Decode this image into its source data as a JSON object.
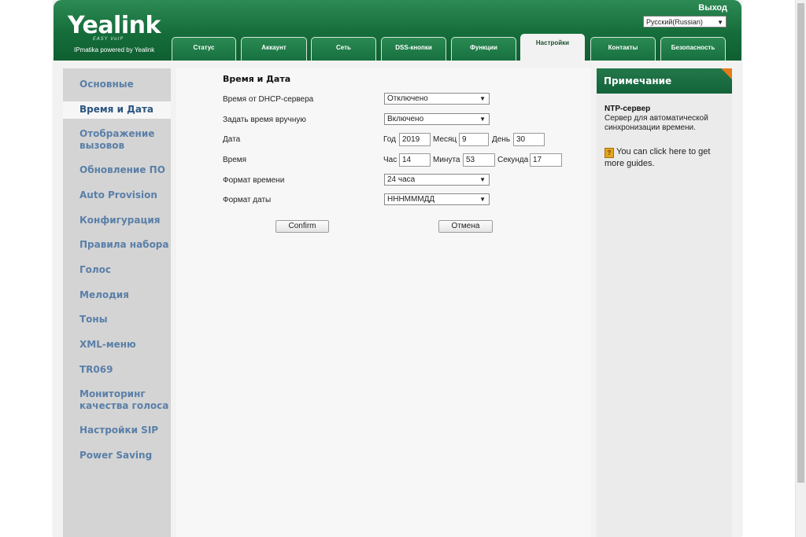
{
  "header": {
    "logo": "Yealink",
    "logo_tagline": "EASY VoIP",
    "subtitle": "IPmatika powered by Yealink",
    "logout": "Выход",
    "language": "Русский(Russian)"
  },
  "tabs": [
    {
      "label": "Статус"
    },
    {
      "label": "Аккаунт"
    },
    {
      "label": "Сеть"
    },
    {
      "label": "DSS-кнопки"
    },
    {
      "label": "Функции"
    },
    {
      "label": "Настройки"
    },
    {
      "label": "Контакты"
    },
    {
      "label": "Безопасность"
    }
  ],
  "active_tab": "Настройки",
  "sidebar": {
    "items": [
      {
        "label": "Основные"
      },
      {
        "label": "Время и Дата"
      },
      {
        "label": "Отображение\nвызовов"
      },
      {
        "label": "Обновление ПО"
      },
      {
        "label": "Auto Provision"
      },
      {
        "label": "Конфигурация"
      },
      {
        "label": "Правила набора"
      },
      {
        "label": "Голос"
      },
      {
        "label": "Мелодия"
      },
      {
        "label": "Тоны"
      },
      {
        "label": "XML-меню"
      },
      {
        "label": "TR069"
      },
      {
        "label": "Мониторинг\nкачества голоса"
      },
      {
        "label": "Настройки SIP"
      },
      {
        "label": "Power Saving"
      }
    ],
    "active": "Время и Дата"
  },
  "form": {
    "title": "Время и Дата",
    "dhcp_time": {
      "label": "Время от DHCP-сервера",
      "value": "Отключено"
    },
    "manual_time": {
      "label": "Задать время вручную",
      "value": "Включено"
    },
    "date": {
      "label": "Дата",
      "year_label": "Год",
      "year": "2019",
      "month_label": "Месяц",
      "month": "9",
      "day_label": "День",
      "day": "30"
    },
    "time": {
      "label": "Время",
      "hour_label": "Час",
      "hour": "14",
      "minute_label": "Минута",
      "minute": "53",
      "second_label": "Секунда",
      "second": "17"
    },
    "time_format": {
      "label": "Формат времени",
      "value": "24 часа"
    },
    "date_format": {
      "label": "Формат даты",
      "value": "ННHMMMДД"
    },
    "confirm_label": "Confirm",
    "cancel_label": "Отмена"
  },
  "note": {
    "heading": "Примечание",
    "title": "NTP-сервер",
    "text": "Сервер для автоматической синхронизации времени.",
    "guide": "You can click here to get more guides."
  },
  "colors": {
    "header_green": "#156d3a",
    "sidebar_link": "#5a7fa8",
    "note_corner": "#e57c1c"
  }
}
